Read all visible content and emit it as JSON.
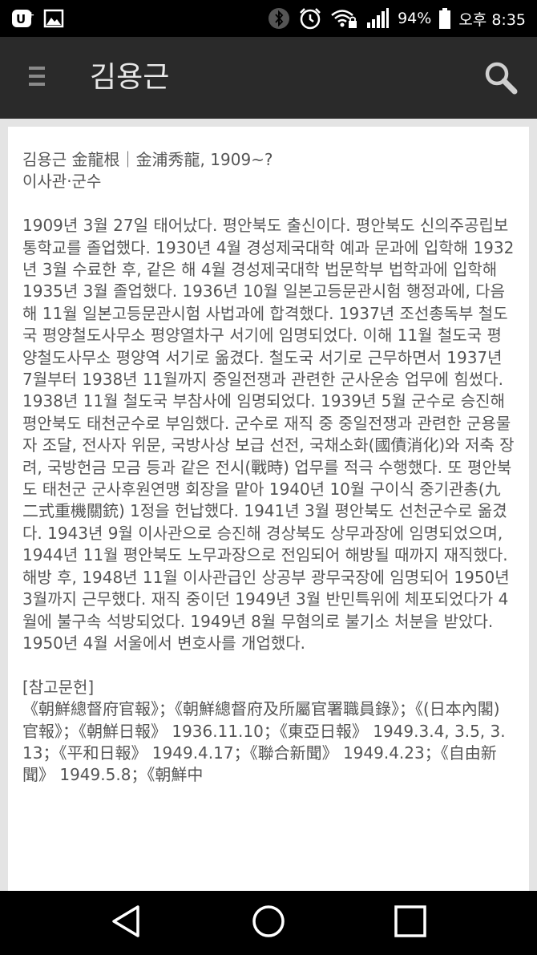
{
  "status_bar": {
    "icons": [
      "uplus-icon",
      "gallery-icon",
      "bluetooth-icon",
      "alarm-icon",
      "wifi-lock-icon",
      "signal-icon",
      "battery-icon"
    ],
    "battery": "94%",
    "time": "오후 8:35"
  },
  "app_bar": {
    "title": "김용근",
    "menu_icon": "hamburger-icon",
    "search_icon": "search-icon"
  },
  "article": {
    "heading": "김용근 金龍根｜金浦秀龍, 1909~?",
    "position": "이사관·군수",
    "paragraphs": [
      "1909년 3월 27일 태어났다. 평안북도 출신이다. 평안북도 신의주공립보통학교를 졸업했다. 1930년 4월 경성제국대학 예과 문과에 입학해 1932년 3월 수료한 후, 같은 해 4월 경성제국대학 법문학부 법학과에 입학해 1935년 3월 졸업했다. 1936년 10월 일본고등문관시험 행정과에, 다음 해 11월 일본고등문관시험 사법과에 합격했다. 1937년 조선총독부 철도국 평양철도사무소 평양열차구 서기에 임명되었다. 이해 11월 철도국 평양철도사무소 평양역 서기로 옮겼다. 철도국 서기로 근무하면서 1937년 7월부터 1938년 11월까지 중일전쟁과 관련한 군사운송 업무에 힘썼다. 1938년 11월 철도국 부참사에 임명되었다. 1939년 5월 군수로 승진해 평안북도 태천군수로 부임했다. 군수로 재직 중 중일전쟁과 관련한 군용물자 조달, 전사자 위문, 국방사상 보급 선전, 국채소화(國債消化)와 저축 장려, 국방헌금 모금 등과 같은 전시(戰時) 업무를 적극 수행했다. 또 평안북도 태천군 군사후원연맹 회장을 맡아 1940년 10월 구이식 중기관총(九二式重機關銃) 1정을 헌납했다. 1941년 3월 평안북도 선천군수로 옮겼다. 1943년 9월 이사관으로 승진해 경상북도 상무과장에 임명되었으며, 1944년 11월 평안북도 노무과장으로 전임되어 해방될 때까지 재직했다.",
      "해방 후, 1948년 11월 이사관급인 상공부 광무국장에 임명되어 1950년 3월까지 근무했다. 재직 중이던 1949년 3월 반민특위에 체포되었다가 4월에 불구속 석방되었다. 1949년 8월 무혐의로 불기소 처분을 받았다. 1950년 4월 서울에서 변호사를 개업했다."
    ],
    "references_title": "[참고문헌]",
    "references": "《朝鮮總督府官報》；《朝鮮總督府及所屬官署職員錄》；《(日本內閣)官報》；《朝鮮日報》 1936.11.10；《東亞日報》 1949.3.4, 3.5, 3.13；《平和日報》 1949.4.17；《聯合新聞》 1949.4.23；《自由新聞》 1949.5.8；《朝鮮中"
  },
  "nav_bar": {
    "buttons": [
      "back-icon",
      "home-icon",
      "recents-icon"
    ]
  },
  "colors": {
    "status_bar": "#000000",
    "app_bar": "#2a2a2a",
    "content_bg": "#e4e4e4",
    "card_bg": "#ffffff",
    "body_text": "#555555",
    "nav_bar": "#000000"
  }
}
